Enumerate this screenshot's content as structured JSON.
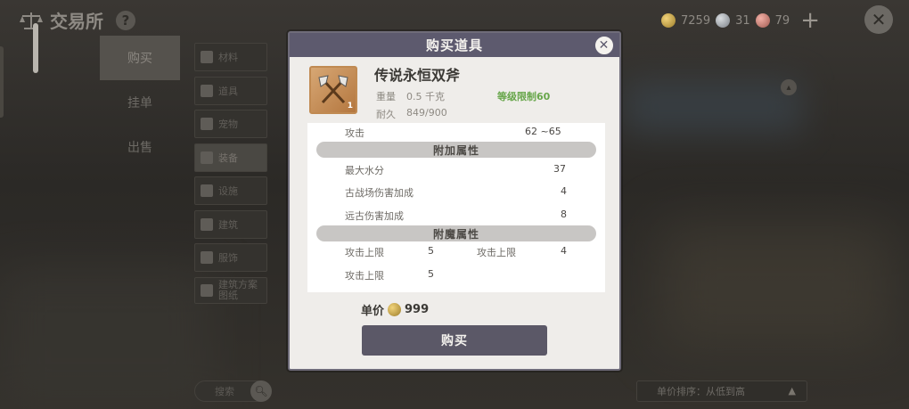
{
  "top_bar": {
    "title": "交易所",
    "help": "?",
    "currency": [
      {
        "icon": "gold-coin-icon",
        "value": "7259"
      },
      {
        "icon": "silver-coin-icon",
        "value": "31"
      },
      {
        "icon": "pink-coin-icon",
        "value": "79"
      }
    ],
    "add": "+",
    "close": "✕"
  },
  "nav": {
    "items": [
      {
        "label": "购买",
        "active": true
      },
      {
        "label": "挂单",
        "active": false
      },
      {
        "label": "出售",
        "active": false
      }
    ]
  },
  "categories": [
    {
      "label": "材料"
    },
    {
      "label": "道具"
    },
    {
      "label": "宠物"
    },
    {
      "label": "装备",
      "active": true
    },
    {
      "label": "设施"
    },
    {
      "label": "建筑"
    },
    {
      "label": "服饰"
    },
    {
      "label": "建筑方案图纸"
    }
  ],
  "search": {
    "label": "搜索"
  },
  "sort": {
    "label": "单价排序：从低到高"
  },
  "modal": {
    "title": "购买道具",
    "close": "✕",
    "item": {
      "name": "传说永恒双斧",
      "level_badge": "1",
      "weight_label": "重量",
      "weight_value": "0.5 千克",
      "durability_label": "耐久",
      "durability_value": "849/900",
      "level_limit": "等级限制60"
    },
    "stats": {
      "attack_label": "攻击",
      "attack_value": "62 ~65",
      "extra_section": "附加属性",
      "extra": [
        {
          "label": "最大水分",
          "value": "37"
        },
        {
          "label": "古战场伤害加成",
          "value": "4"
        },
        {
          "label": "远古伤害加成",
          "value": "8"
        }
      ],
      "enchant_section": "附魔属性",
      "enchant": [
        {
          "label": "攻击上限",
          "value": "5"
        },
        {
          "label": "攻击上限",
          "value": "4"
        },
        {
          "label": "攻击上限",
          "value": "5"
        }
      ]
    },
    "price_label": "单价",
    "price_value": "999",
    "buy_label": "购买"
  }
}
